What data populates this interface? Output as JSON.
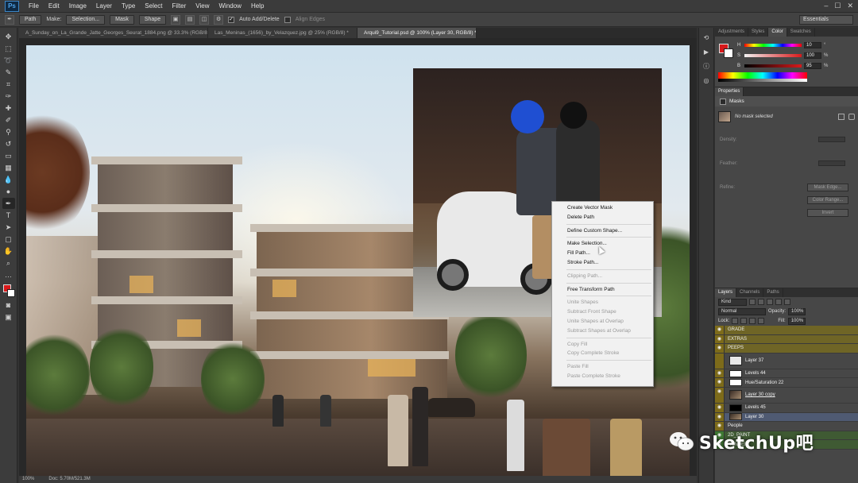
{
  "app": {
    "logo": "Ps"
  },
  "menubar": {
    "items": [
      "File",
      "Edit",
      "Image",
      "Layer",
      "Type",
      "Select",
      "Filter",
      "View",
      "Window",
      "Help"
    ]
  },
  "optionsbar": {
    "mode": "Path",
    "make_label": "Make:",
    "selection_btn": "Selection...",
    "mask_btn": "Mask",
    "shape_btn": "Shape",
    "auto_add_delete": "Auto Add/Delete",
    "align_edges": "Align Edges",
    "workspace": "Essentials"
  },
  "doctabs": [
    {
      "label": "A_Sunday_on_La_Grande_Jatte_Georges_Seurat_1884.png @ 33.3% (RGB/8) *",
      "active": false
    },
    {
      "label": "Las_Meninas_(1656)_by_Velazquez.jpg @ 25% (RGB/8) *",
      "active": false
    },
    {
      "label": "Arqui9_Tutorial.psd @ 100% (Layer 30, RGB/8) *",
      "active": true
    }
  ],
  "context_menu": {
    "items": [
      {
        "label": "Create Vector Mask",
        "enabled": true
      },
      {
        "label": "Delete Path",
        "enabled": true
      },
      {
        "sep": true
      },
      {
        "label": "Define Custom Shape...",
        "enabled": true
      },
      {
        "sep": true
      },
      {
        "label": "Make Selection...",
        "enabled": true
      },
      {
        "label": "Fill Path...",
        "enabled": true
      },
      {
        "label": "Stroke Path...",
        "enabled": true
      },
      {
        "sep": true
      },
      {
        "label": "Clipping Path...",
        "enabled": false
      },
      {
        "sep": true
      },
      {
        "label": "Free Transform Path",
        "enabled": true
      },
      {
        "sep": true
      },
      {
        "label": "Unite Shapes",
        "enabled": false
      },
      {
        "label": "Subtract Front Shape",
        "enabled": false
      },
      {
        "label": "Unite Shapes at Overlap",
        "enabled": false
      },
      {
        "label": "Subtract Shapes at Overlap",
        "enabled": false
      },
      {
        "sep": true
      },
      {
        "label": "Copy Fill",
        "enabled": false
      },
      {
        "label": "Copy Complete Stroke",
        "enabled": false
      },
      {
        "sep": true
      },
      {
        "label": "Paste Fill",
        "enabled": false
      },
      {
        "label": "Paste Complete Stroke",
        "enabled": false
      }
    ]
  },
  "statusbar": {
    "zoom": "100%",
    "doc": "Doc: 5.70M/521.3M"
  },
  "color_panel": {
    "tabs": [
      "Adjustments",
      "Styles",
      "Color",
      "Swatches"
    ],
    "active_tab": "Color",
    "fg_color": "#d8191b",
    "rows": [
      {
        "label": "H",
        "value": "10",
        "unit": "°"
      },
      {
        "label": "S",
        "value": "100",
        "unit": "%"
      },
      {
        "label": "B",
        "value": "95",
        "unit": "%"
      }
    ]
  },
  "properties": {
    "tab": "Properties",
    "header": "Masks",
    "mask_status": "No mask selected",
    "density": "Density:",
    "feather": "Feather:",
    "refine": "Refine:",
    "mask_edge_btn": "Mask Edge...",
    "color_range_btn": "Color Range...",
    "invert_btn": "Invert"
  },
  "layers": {
    "tabs": [
      "Layers",
      "Channels",
      "Paths"
    ],
    "filter": "Kind",
    "blend_mode": "Normal",
    "opacity_label": "Opacity:",
    "opacity": "100%",
    "lock_label": "Lock:",
    "fill_label": "Fill:",
    "fill": "100%",
    "items": [
      {
        "name": "GRADE",
        "kind": "group"
      },
      {
        "name": "EXTRAS",
        "kind": "group"
      },
      {
        "name": "PEEPS",
        "kind": "group"
      },
      {
        "name": "Layer 37",
        "kind": "layer"
      },
      {
        "name": "Levels 44",
        "kind": "adjust"
      },
      {
        "name": "Hue/Saturation 22",
        "kind": "adjust"
      },
      {
        "name": "Layer 30 copy",
        "kind": "layer"
      },
      {
        "name": "Levels 45",
        "kind": "adjust"
      },
      {
        "name": "Layer 30",
        "kind": "selected"
      },
      {
        "name": "People",
        "kind": "group"
      },
      {
        "name": "2D_PAINT",
        "kind": "group"
      },
      {
        "name": "RENDER",
        "kind": "group"
      }
    ]
  },
  "watermark": {
    "text": "SketchUp吧"
  }
}
